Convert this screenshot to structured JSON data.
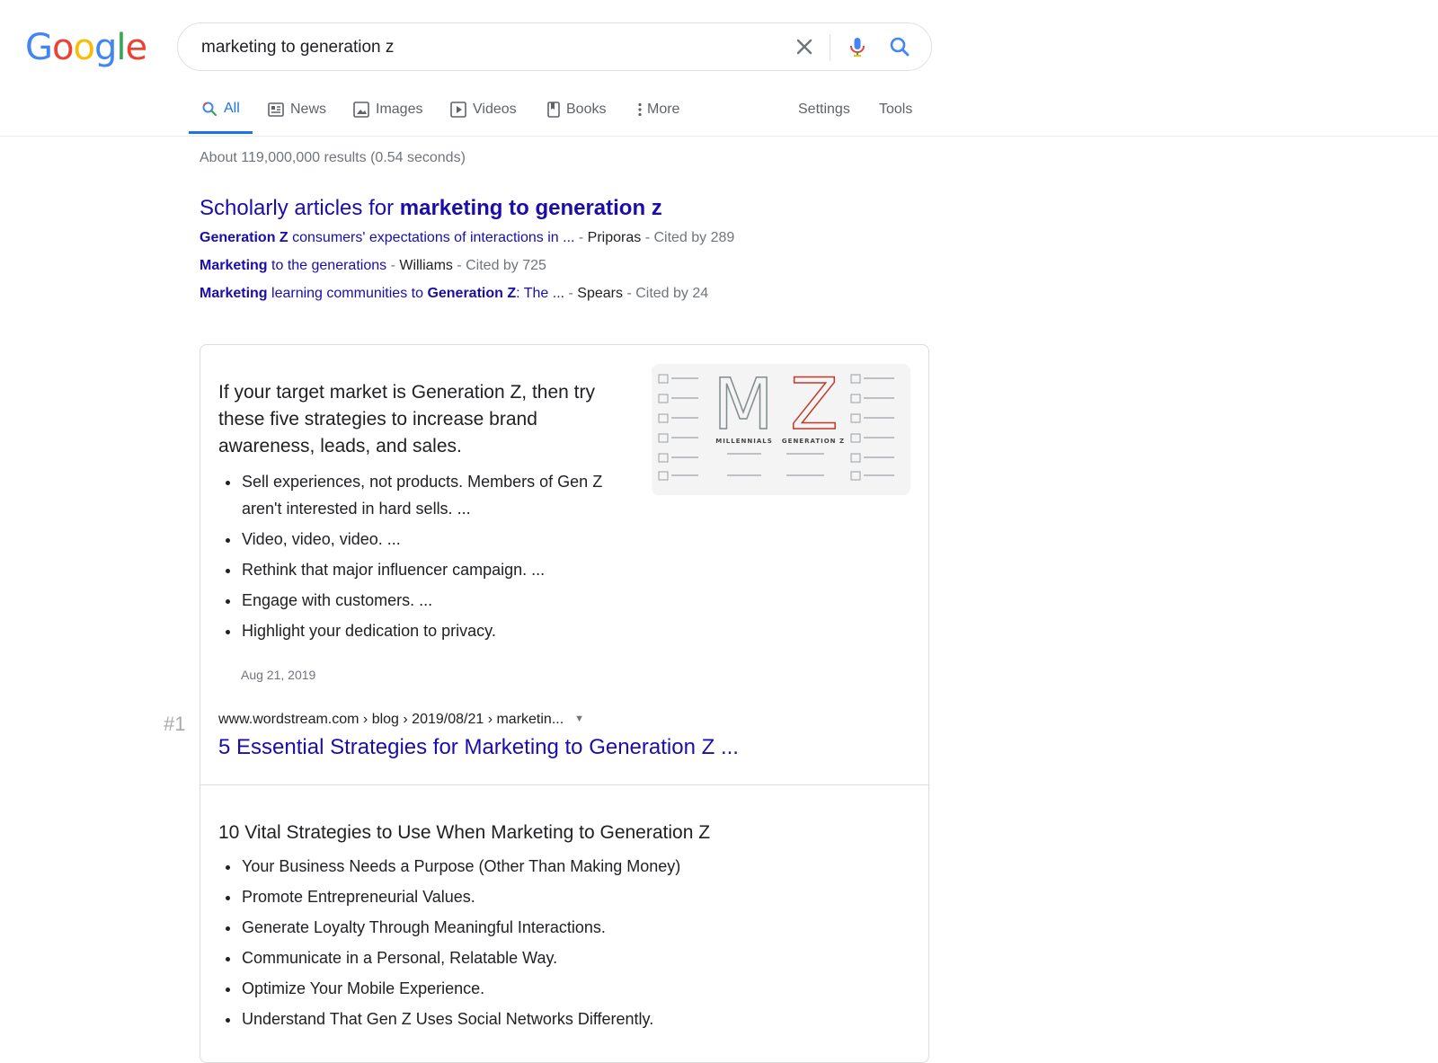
{
  "logo": {
    "letters": [
      "G",
      "o",
      "o",
      "g",
      "l",
      "e"
    ],
    "colors": [
      "#4285F4",
      "#EA4335",
      "#FBBC05",
      "#4285F4",
      "#34A853",
      "#EA4335"
    ]
  },
  "search": {
    "query": "marketing to generation z"
  },
  "tabs": [
    {
      "label": "All",
      "icon": "search-icon",
      "active": true
    },
    {
      "label": "News",
      "icon": "newspaper-icon"
    },
    {
      "label": "Images",
      "icon": "image-icon"
    },
    {
      "label": "Videos",
      "icon": "play-icon"
    },
    {
      "label": "Books",
      "icon": "book-icon"
    },
    {
      "label": "More",
      "icon": "more-vert-icon"
    }
  ],
  "tools": {
    "settings": "Settings",
    "tools": "Tools"
  },
  "stats": "About 119,000,000 results (0.54 seconds)",
  "scholarly": {
    "title_prefix": "Scholarly articles for ",
    "title_bold": "marketing to generation z",
    "articles": [
      {
        "segments": [
          {
            "text": "Generation Z",
            "bold": true
          },
          {
            "text": " consumers' expectations of interactions in ..."
          }
        ],
        "author": "Priporas",
        "cited": "Cited by 289"
      },
      {
        "segments": [
          {
            "text": "Marketing",
            "bold": true
          },
          {
            "text": " to the generations"
          }
        ],
        "author": "Williams",
        "cited": "Cited by 725"
      },
      {
        "segments": [
          {
            "text": "Marketing",
            "bold": true
          },
          {
            "text": " learning communities to "
          },
          {
            "text": "Generation Z",
            "bold": true
          },
          {
            "text": ": The ..."
          }
        ],
        "author": "Spears",
        "cited": "Cited by 24"
      }
    ],
    "separator": " - "
  },
  "featured": {
    "heading": "If your target market is Generation Z, then try these five strategies to increase brand awareness, leads, and sales.",
    "bullets": [
      "Sell experiences, not products. Members of Gen Z aren't interested in hard sells. ...",
      "Video, video, video. ...",
      "Rethink that major influencer campaign. ...",
      "Engage with customers. ...",
      "Highlight your dedication to privacy."
    ],
    "date": "Aug 21, 2019",
    "image": {
      "left_label": "MILLENNIALS",
      "right_label": "GENERATION Z",
      "left_letter": "M",
      "right_letter": "Z"
    },
    "rank": "#1",
    "breadcrumb": "www.wordstream.com › blog › 2019/08/21 › marketin...",
    "title": "5 Essential Strategies for Marketing to Generation Z ..."
  },
  "second": {
    "heading": "10 Vital Strategies to Use When Marketing to Generation Z",
    "bullets": [
      "Your Business Needs a Purpose (Other Than Making Money)",
      "Promote Entrepreneurial Values.",
      "Generate Loyalty Through Meaningful Interactions.",
      "Communicate in a Personal, Relatable Way.",
      "Optimize Your Mobile Experience.",
      "Understand That Gen Z Uses Social Networks Differently."
    ]
  }
}
